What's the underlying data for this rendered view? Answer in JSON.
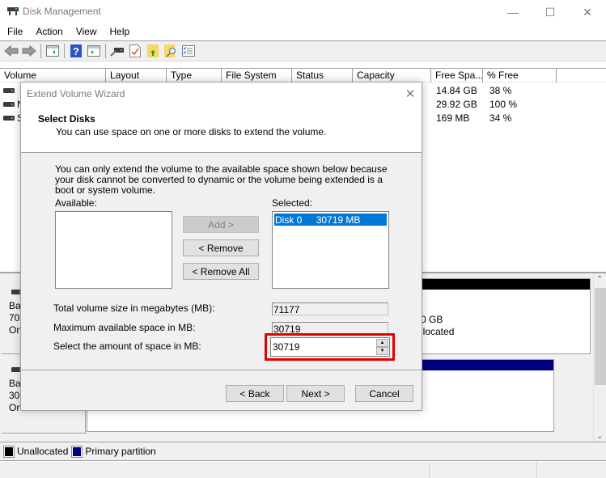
{
  "window": {
    "title": "Disk Management",
    "app_icon": "disk-management-icon",
    "controls": {
      "minimize": "—",
      "maximize": "☐",
      "close": "✕"
    }
  },
  "menu": [
    "File",
    "Action",
    "View",
    "Help"
  ],
  "toolbar": {
    "icons": [
      "back-arrow-icon",
      "forward-arrow-icon",
      "show-hide-console-tree-icon",
      "help-icon",
      "show-hide-action-pane-icon",
      "connect-drive-icon",
      "check-properties-icon",
      "open-folder-up-icon",
      "search-folder-icon",
      "properties-list-icon"
    ]
  },
  "volume_list": {
    "columns": [
      "Volume",
      "Layout",
      "Type",
      "File System",
      "Status",
      "Capacity",
      "Free Spa...",
      "% Free"
    ],
    "rows": [
      {
        "volume": "",
        "free_space": "14.84 GB",
        "percent_free": "38 %"
      },
      {
        "volume": "N",
        "free_space": "29.92 GB",
        "percent_free": "100 %"
      },
      {
        "volume": "S",
        "free_space": "169 MB",
        "percent_free": "34 %"
      }
    ]
  },
  "disks": [
    {
      "label_lines": [
        "Bas",
        "70.",
        "On"
      ],
      "partition_text": [
        "0 GB",
        "llocated"
      ],
      "bar_color": "#000000"
    },
    {
      "label_lines": [
        "Bas",
        "30.",
        "On"
      ],
      "partition_text": [],
      "bar_color": "#000080"
    }
  ],
  "legend": [
    {
      "label": "Unallocated",
      "color": "#000000"
    },
    {
      "label": "Primary partition",
      "color": "#000080"
    }
  ],
  "wizard": {
    "title": "Extend Volume Wizard",
    "close": "✕",
    "step_title": "Select Disks",
    "step_subtitle": "You can use space on one or more disks to extend the volume.",
    "explanation": "You can only extend the volume to the available space shown below because your disk cannot be converted to dynamic or the volume being extended is a boot or system volume.",
    "available_label": "Available:",
    "selected_label": "Selected:",
    "available_items": [],
    "selected_items": [
      {
        "disk": "Disk 0",
        "size": "30719 MB"
      }
    ],
    "buttons": {
      "add": "Add >",
      "remove": "< Remove",
      "remove_all": "< Remove All",
      "back": "< Back",
      "next": "Next >",
      "cancel": "Cancel"
    },
    "fields": {
      "total_label": "Total volume size in megabytes (MB):",
      "total_value": "71177",
      "max_label": "Maximum available space in MB:",
      "max_value": "30719",
      "amount_label": "Select the amount of space in MB:",
      "amount_value": "30719"
    },
    "highlight_color": "#e00000",
    "selection_color": "#0078d7"
  }
}
